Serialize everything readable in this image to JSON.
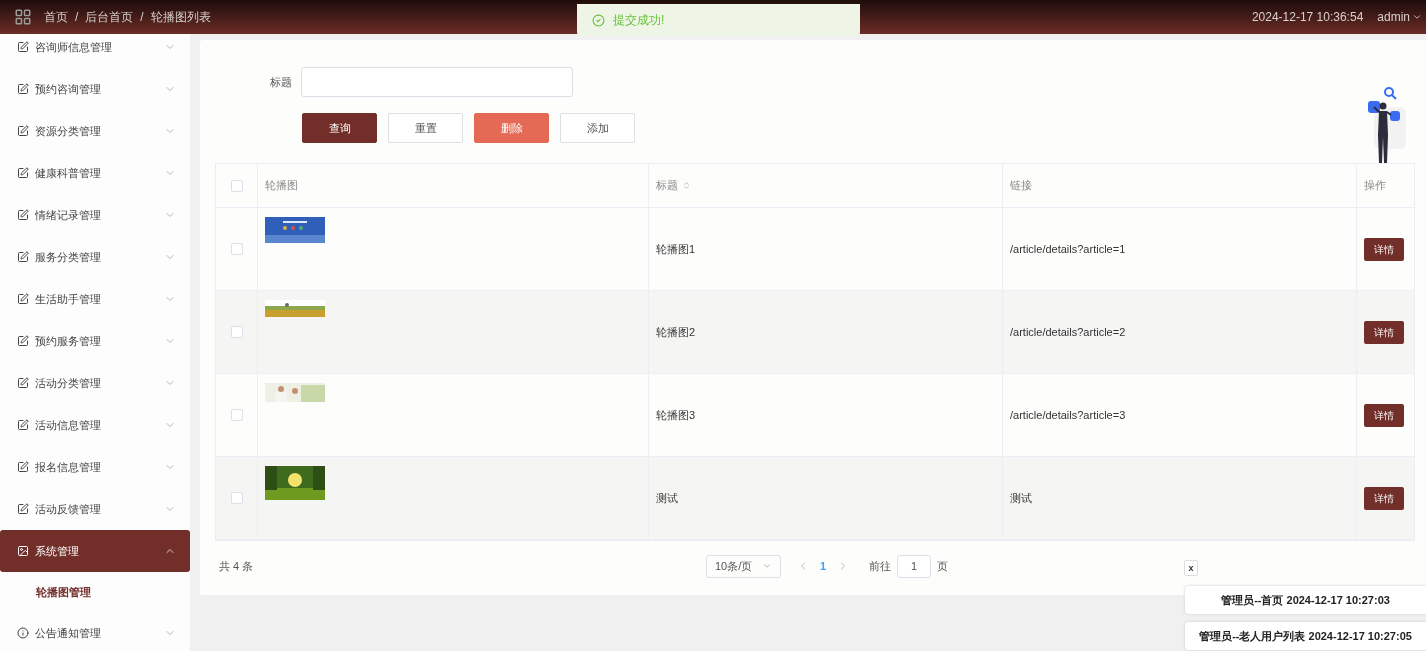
{
  "header": {
    "breadcrumb": [
      "首页",
      "后台首页",
      "轮播图列表"
    ],
    "separator": "/",
    "datetime": "2024-12-17 10:36:54",
    "user": "admin"
  },
  "toast": {
    "message": "提交成功!"
  },
  "sidebar": {
    "items": [
      {
        "label": "咨询师信息管理",
        "kind": "edit",
        "expanded": false,
        "selected": false
      },
      {
        "label": "预约咨询管理",
        "kind": "edit",
        "expanded": false,
        "selected": false
      },
      {
        "label": "资源分类管理",
        "kind": "edit",
        "expanded": false,
        "selected": false
      },
      {
        "label": "健康科普管理",
        "kind": "edit",
        "expanded": false,
        "selected": false
      },
      {
        "label": "情绪记录管理",
        "kind": "edit",
        "expanded": false,
        "selected": false
      },
      {
        "label": "服务分类管理",
        "kind": "edit",
        "expanded": false,
        "selected": false
      },
      {
        "label": "生活助手管理",
        "kind": "edit",
        "expanded": false,
        "selected": false
      },
      {
        "label": "预约服务管理",
        "kind": "edit",
        "expanded": false,
        "selected": false
      },
      {
        "label": "活动分类管理",
        "kind": "edit",
        "expanded": false,
        "selected": false
      },
      {
        "label": "活动信息管理",
        "kind": "edit",
        "expanded": false,
        "selected": false
      },
      {
        "label": "报名信息管理",
        "kind": "edit",
        "expanded": false,
        "selected": false
      },
      {
        "label": "活动反馈管理",
        "kind": "edit",
        "expanded": false,
        "selected": false
      },
      {
        "label": "系统管理",
        "expanded": true,
        "selected": true,
        "children": [
          {
            "label": "轮播图管理"
          }
        ]
      },
      {
        "label": "公告通知管理",
        "kind": "info",
        "expanded": false,
        "selected": false
      }
    ]
  },
  "search": {
    "label": "标题"
  },
  "buttons": [
    {
      "label": "查询",
      "kind": "primary"
    },
    {
      "label": "重置",
      "kind": "plain"
    },
    {
      "label": "删除",
      "kind": "danger"
    },
    {
      "label": "添加",
      "kind": "plain"
    }
  ],
  "table": {
    "all_checked": false,
    "columns": [
      "轮播图",
      "标题",
      "链接",
      "操作"
    ],
    "rows": [
      {
        "checked": false,
        "kind": "picture",
        "title": "轮播图1",
        "link": "/article/details?article=1",
        "action": "详情"
      },
      {
        "checked": false,
        "kind": "picture",
        "title": "轮播图2",
        "link": "/article/details?article=2",
        "action": "详情"
      },
      {
        "checked": false,
        "kind": "picture",
        "title": "轮播图3",
        "link": "/article/details?article=3",
        "action": "详情"
      },
      {
        "checked": false,
        "kind": "picture",
        "title": "测试",
        "link": "测试",
        "action": "详情"
      }
    ]
  },
  "pagination": {
    "total": "共 4 条",
    "page_size": "10条/页",
    "pages": [
      {
        "label": "1",
        "selected": true
      }
    ],
    "goto_label": "前往",
    "goto_value": "1",
    "goto_suffix": "页"
  },
  "notifications": {
    "close": "x",
    "items": [
      "管理员--首页 2024-12-17 10:27:03",
      "管理员--老人用户列表 2024-12-17 10:27:05"
    ]
  }
}
